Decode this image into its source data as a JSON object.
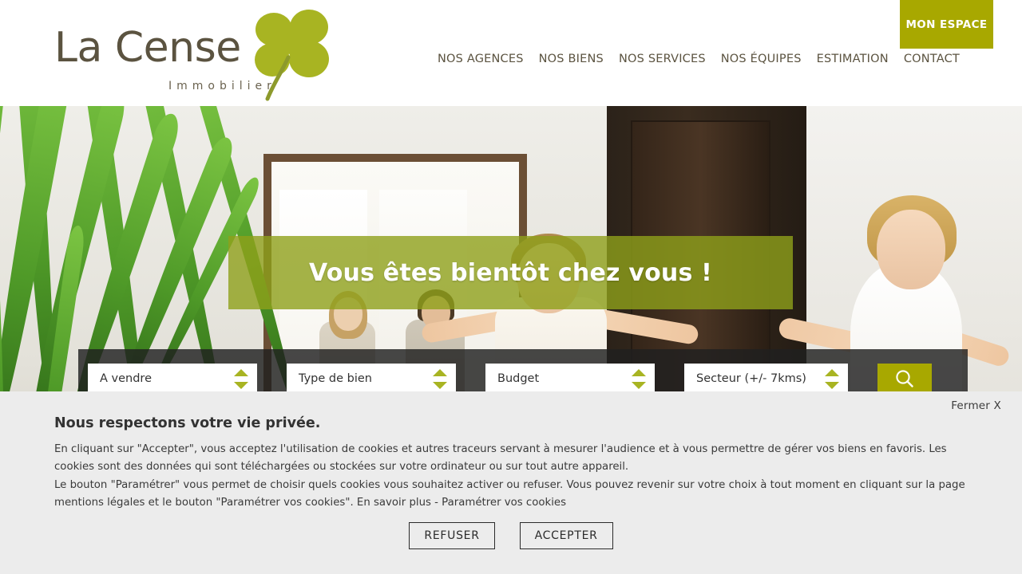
{
  "header": {
    "logo": {
      "name": "La Cense",
      "tagline": "Immobilier",
      "icon": "clover-icon",
      "color": "#a8b422",
      "text_color": "#5b5340"
    },
    "nav": [
      {
        "label": "NOS AGENCES",
        "name": "nav-nos-agences"
      },
      {
        "label": "NOS BIENS",
        "name": "nav-nos-biens"
      },
      {
        "label": "NOS SERVICES",
        "name": "nav-nos-services"
      },
      {
        "label": "NOS ÉQUIPES",
        "name": "nav-nos-equipes"
      },
      {
        "label": "ESTIMATION",
        "name": "nav-estimation"
      },
      {
        "label": "CONTACT",
        "name": "nav-contact"
      }
    ],
    "account_button": {
      "label": "MON ESPACE",
      "background": "#a8a800",
      "text_color": "#ffffff"
    }
  },
  "hero": {
    "title": "Vous êtes bientôt chez vous !",
    "band_color": "#8fa01a",
    "title_color": "#ffffff"
  },
  "search": {
    "fields": [
      {
        "value": "A vendre",
        "name": "select-transaction",
        "icon": "spinner-updown-icon"
      },
      {
        "value": "Type de bien",
        "name": "select-property-type",
        "icon": "spinner-updown-icon"
      },
      {
        "value": "Budget",
        "name": "select-budget",
        "icon": "spinner-updown-icon"
      },
      {
        "value": "Secteur (+/- 7kms)",
        "name": "select-sector",
        "icon": "spinner-updown-icon"
      }
    ],
    "submit": {
      "icon": "search-icon",
      "background": "#a8a800"
    }
  },
  "cookie_banner": {
    "close_label": "Fermer X",
    "title": "Nous respectons votre vie privée.",
    "paragraph_1": "En cliquant sur \"Accepter\", vous acceptez l'utilisation de cookies et autres traceurs servant à mesurer l'audience et à vous permettre de gérer vos biens en favoris. Les cookies sont des données qui sont téléchargées ou stockées sur votre ordinateur ou sur tout autre appareil.",
    "paragraph_2": "Le bouton \"Paramétrer\" vous permet de choisir quels cookies vous souhaitez activer ou refuser. Vous pouvez revenir sur votre choix à tout moment en cliquant sur la page mentions légales et le bouton \"Paramétrer vos cookies\". En savoir plus - Paramétrer vos cookies",
    "refuse_label": "REFUSER",
    "accept_label": "ACCEPTER",
    "background": "#ececec"
  }
}
